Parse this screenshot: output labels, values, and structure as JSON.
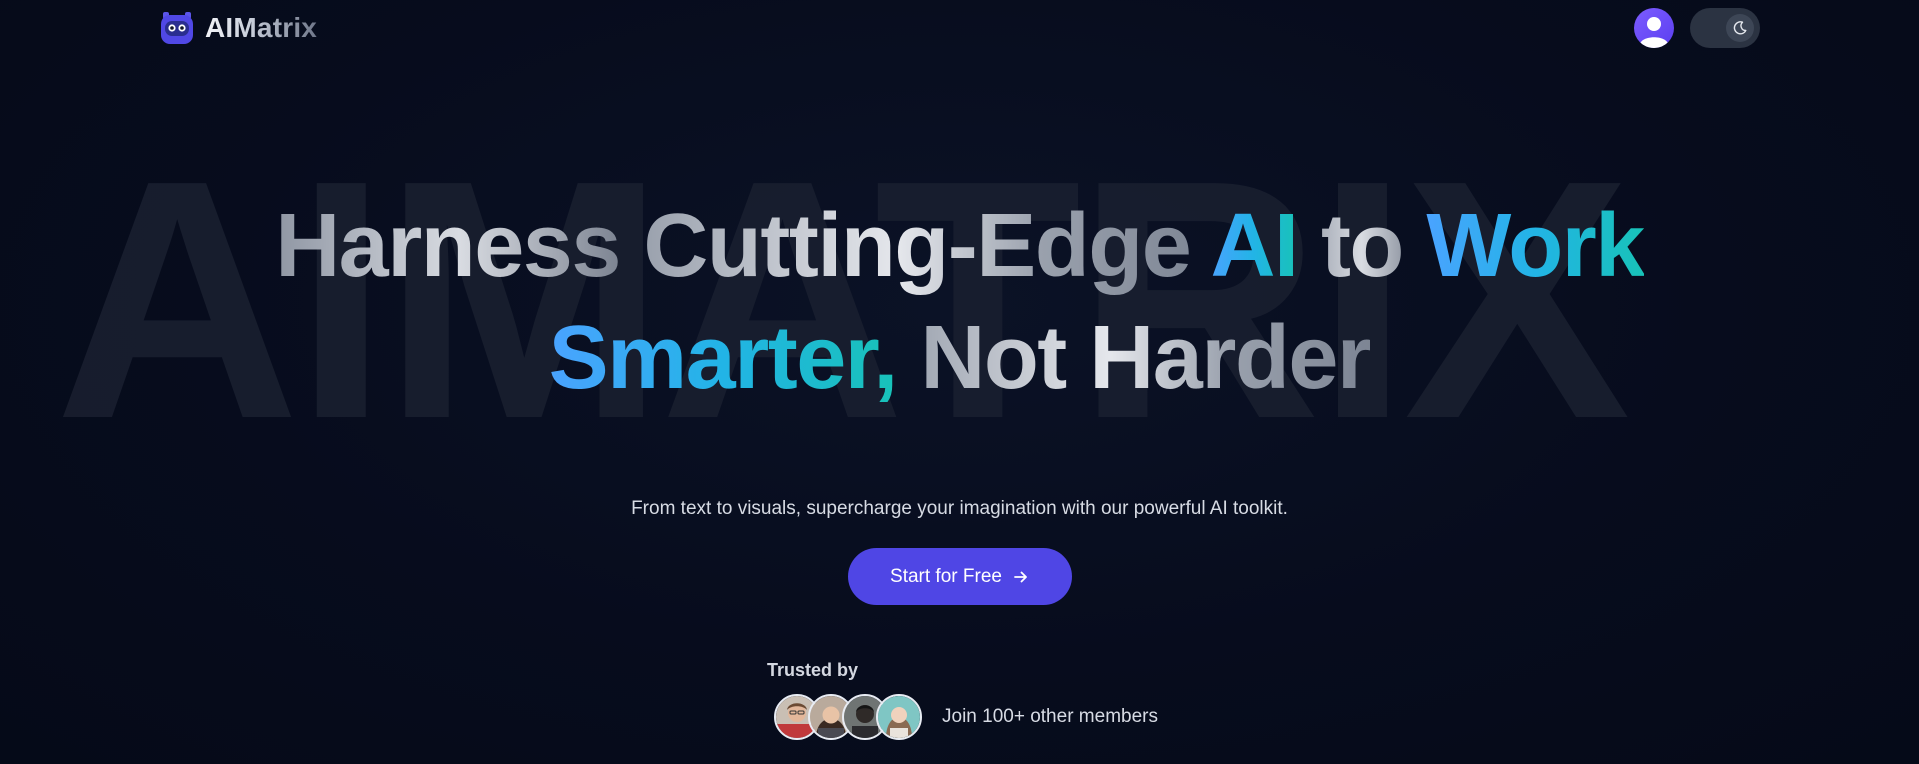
{
  "header": {
    "brand": "AIMatrix",
    "logo_icon": "robot-face-icon",
    "profile_icon": "user-icon",
    "theme_icon": "moon-icon"
  },
  "watermark": "AIMATRIX",
  "hero": {
    "line1": {
      "part1": "Harness ",
      "part2": "Cutting-Edge ",
      "part3": "AI",
      "part4": " to ",
      "part5": "Work"
    },
    "line2": {
      "part1": "Smarter,",
      "part2": " Not Harder"
    },
    "subtitle": "From text to visuals, supercharge your imagination with our powerful AI toolkit.",
    "cta_label": "Start for Free",
    "cta_icon": "arrow-right-icon"
  },
  "social_proof": {
    "trusted_label": "Trusted by",
    "members_text": "Join 100+ other members",
    "avatar_count": 4
  },
  "colors": {
    "background": "#060b1c",
    "cta": "#4f46e5",
    "avatar": "#6d4cff",
    "gradient_blue_start": "#4aa3ff",
    "gradient_teal_end": "#18c2b8"
  }
}
